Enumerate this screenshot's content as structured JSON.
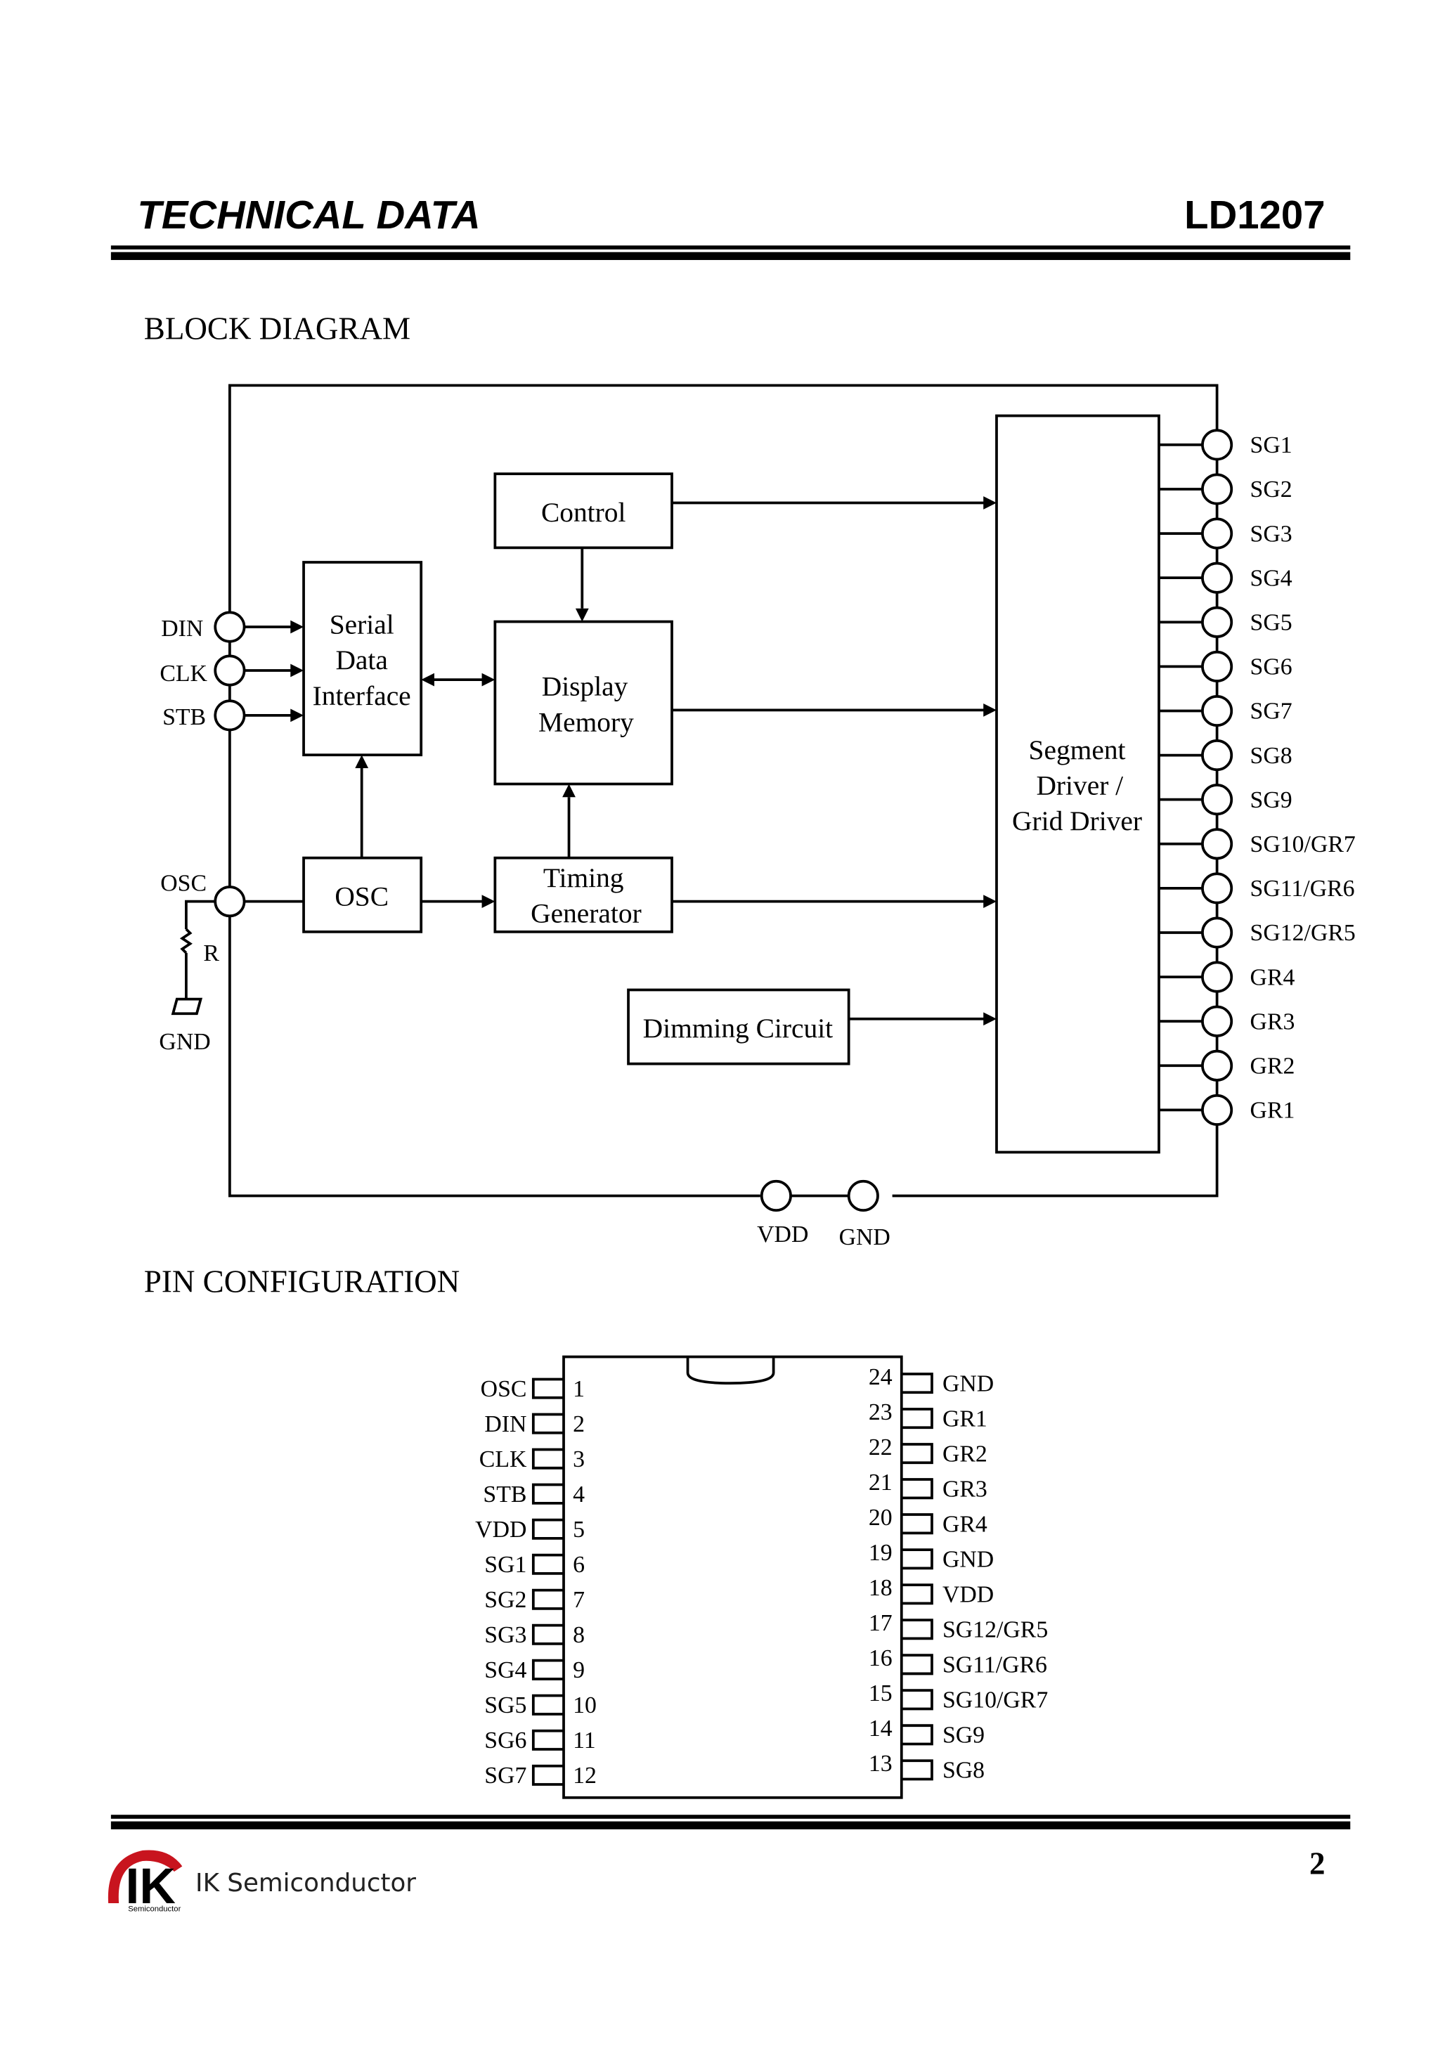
{
  "header": {
    "title": "TECHNICAL DATA",
    "part_number": "LD1207"
  },
  "block_diagram": {
    "section_title": "BLOCK DIAGRAM",
    "blocks": {
      "control": [
        "Control"
      ],
      "serial": [
        "Serial",
        "Data",
        "Interface"
      ],
      "memory": [
        "Display",
        "Memory"
      ],
      "osc": [
        "OSC"
      ],
      "timing": [
        "Timing",
        "Generator"
      ],
      "dimming": [
        "Dimming Circuit"
      ],
      "driver": [
        "Segment",
        "Driver /",
        "Grid Driver"
      ]
    },
    "input_pins": [
      "DIN",
      "CLK",
      "STB"
    ],
    "osc_pin": "OSC",
    "resistor_label": "R",
    "ground_label": "GND",
    "output_pins": [
      "SG1",
      "SG2",
      "SG3",
      "SG4",
      "SG5",
      "SG6",
      "SG7",
      "SG8",
      "SG9",
      "SG10/GR7",
      "SG11/GR6",
      "SG12/GR5",
      "GR4",
      "GR3",
      "GR2",
      "GR1"
    ],
    "supply_pins": [
      "VDD",
      "GND"
    ]
  },
  "pin_configuration": {
    "section_title": "PIN CONFIGURATION",
    "left_pins": [
      {
        "num": "1",
        "name": "OSC"
      },
      {
        "num": "2",
        "name": "DIN"
      },
      {
        "num": "3",
        "name": "CLK"
      },
      {
        "num": "4",
        "name": "STB"
      },
      {
        "num": "5",
        "name": "VDD"
      },
      {
        "num": "6",
        "name": "SG1"
      },
      {
        "num": "7",
        "name": "SG2"
      },
      {
        "num": "8",
        "name": "SG3"
      },
      {
        "num": "9",
        "name": "SG4"
      },
      {
        "num": "10",
        "name": "SG5"
      },
      {
        "num": "11",
        "name": "SG6"
      },
      {
        "num": "12",
        "name": "SG7"
      }
    ],
    "right_pins": [
      {
        "num": "24",
        "name": "GND"
      },
      {
        "num": "23",
        "name": "GR1"
      },
      {
        "num": "22",
        "name": "GR2"
      },
      {
        "num": "21",
        "name": "GR3"
      },
      {
        "num": "20",
        "name": "GR4"
      },
      {
        "num": "19",
        "name": "GND"
      },
      {
        "num": "18",
        "name": "VDD"
      },
      {
        "num": "17",
        "name": "SG12/GR5"
      },
      {
        "num": "16",
        "name": "SG11/GR6"
      },
      {
        "num": "15",
        "name": "SG10/GR7"
      },
      {
        "num": "14",
        "name": "SG9"
      },
      {
        "num": "13",
        "name": "SG8"
      }
    ]
  },
  "footer": {
    "logo_mark": "IK",
    "logo_sub": "Semiconductor",
    "company": "IK Semiconductor",
    "page_number": "2",
    "brand_color": "#c8141e"
  }
}
